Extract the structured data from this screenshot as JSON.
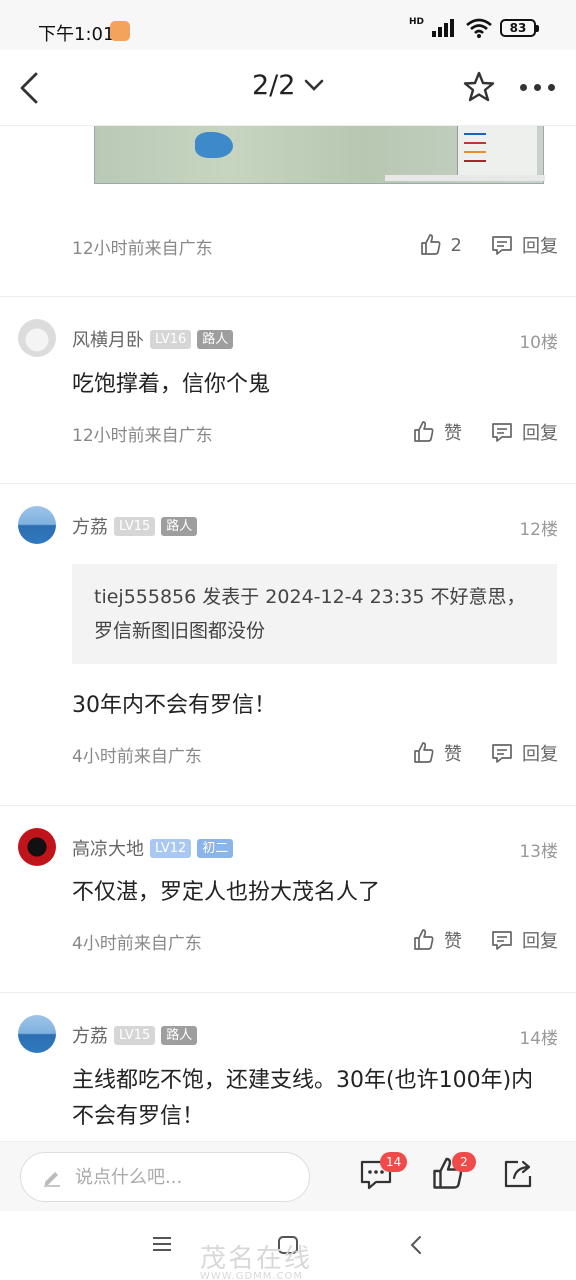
{
  "status_bar": {
    "time": "下午1:01",
    "network": "HD",
    "battery": "83"
  },
  "nav": {
    "page_indicator": "2/2"
  },
  "top_item": {
    "meta": "12小时前来自广东",
    "like_count": "2",
    "reply_label": "回复"
  },
  "posts": [
    {
      "username": "风横月卧",
      "level": "LV16",
      "role": "路人",
      "floor": "10楼",
      "text": "吃饱撑着，信你个鬼",
      "meta": "12小时前来自广东",
      "like_label": "赞",
      "reply_label": "回复"
    },
    {
      "username": "方荔",
      "level": "LV15",
      "role": "路人",
      "floor": "12楼",
      "quote": "tiej555856 发表于 2024-12-4 23:35 不好意思，罗信新图旧图都没份",
      "text": "30年内不会有罗信！",
      "meta": "4小时前来自广东",
      "like_label": "赞",
      "reply_label": "回复"
    },
    {
      "username": "高凉大地",
      "level": "LV12",
      "role": "初二",
      "floor": "13楼",
      "text": "不仅湛，罗定人也扮大茂名人了",
      "meta": "4小时前来自广东",
      "like_label": "赞",
      "reply_label": "回复"
    },
    {
      "username": "方荔",
      "level": "LV15",
      "role": "路人",
      "floor": "14楼",
      "text": "主线都吃不饱，还建支线。30年(也许100年)内不会有罗信！"
    }
  ],
  "bottom_bar": {
    "placeholder": "说点什么吧...",
    "comment_count": "14",
    "like_count": "2"
  },
  "watermark": {
    "text": "茂名在线",
    "sub": "WWW.GDMM.COM"
  },
  "icons": [
    "back-icon",
    "chevron-down-icon",
    "star-icon",
    "more-icon",
    "like-icon",
    "reply-icon",
    "pencil-icon",
    "comment-icon",
    "share-icon",
    "menu-icon",
    "home-icon",
    "back-nav-icon"
  ],
  "colors": {
    "badge_red": "#f04a4a",
    "level_blue": "#a9c8f1",
    "role_gray": "#9e9e9e"
  }
}
